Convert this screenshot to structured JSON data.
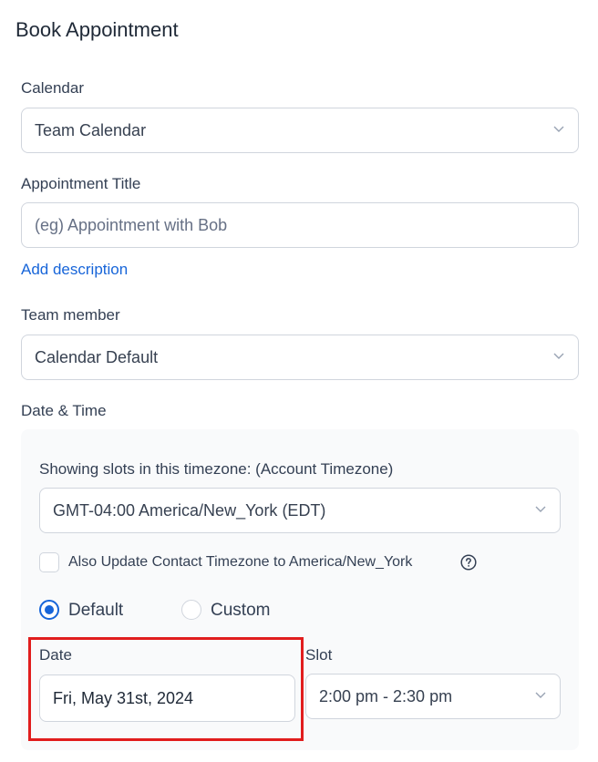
{
  "header": {
    "title": "Book Appointment"
  },
  "calendar": {
    "label": "Calendar",
    "value": "Team Calendar"
  },
  "appointment_title": {
    "label": "Appointment Title",
    "placeholder": "(eg) Appointment with Bob"
  },
  "add_description": "Add description",
  "team_member": {
    "label": "Team member",
    "value": "Calendar Default"
  },
  "date_time": {
    "label": "Date & Time",
    "timezone_label": "Showing slots in this timezone: (Account Timezone)",
    "timezone_value": "GMT-04:00 America/New_York (EDT)",
    "update_contact_tz": {
      "label": "Also Update Contact Timezone to America/New_York",
      "checked": false
    },
    "mode_options": [
      {
        "label": "Default",
        "selected": true
      },
      {
        "label": "Custom",
        "selected": false
      }
    ],
    "date": {
      "label": "Date",
      "value": "Fri, May 31st, 2024"
    },
    "slot": {
      "label": "Slot",
      "value": "2:00 pm - 2:30 pm"
    }
  },
  "colors": {
    "accent": "#1765d9",
    "highlight": "#e11d1d",
    "panel_bg": "#f9fafb"
  }
}
